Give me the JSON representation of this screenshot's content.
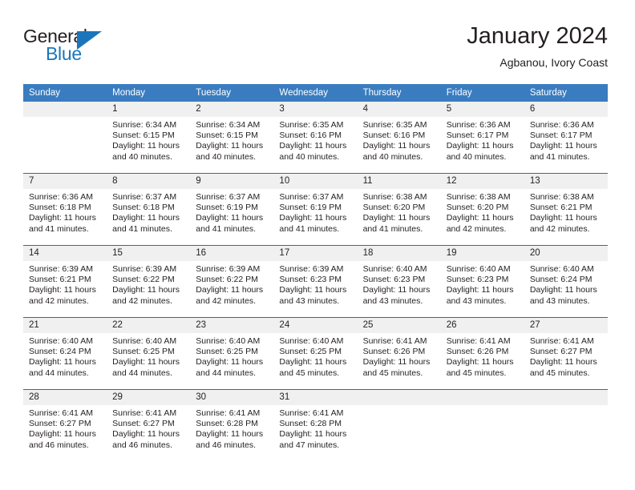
{
  "brand": {
    "word_one": "General",
    "word_two": "Blue",
    "triangle_icon": "brand-triangle-icon",
    "accent_color": "#1b75bb"
  },
  "header": {
    "title": "January 2024",
    "subtitle": "Agbanou, Ivory Coast"
  },
  "calendar": {
    "header_background": "#3a7cc0",
    "daynum_background": "#f0f0f0",
    "weekday_headers": [
      "Sunday",
      "Monday",
      "Tuesday",
      "Wednesday",
      "Thursday",
      "Friday",
      "Saturday"
    ],
    "weeks": [
      [
        {
          "day": "",
          "sunrise": "",
          "sunset": "",
          "daylight_1": "",
          "daylight_2": "",
          "empty": true
        },
        {
          "day": "1",
          "sunrise": "Sunrise: 6:34 AM",
          "sunset": "Sunset: 6:15 PM",
          "daylight_1": "Daylight: 11 hours",
          "daylight_2": "and 40 minutes.",
          "empty": false
        },
        {
          "day": "2",
          "sunrise": "Sunrise: 6:34 AM",
          "sunset": "Sunset: 6:15 PM",
          "daylight_1": "Daylight: 11 hours",
          "daylight_2": "and 40 minutes.",
          "empty": false
        },
        {
          "day": "3",
          "sunrise": "Sunrise: 6:35 AM",
          "sunset": "Sunset: 6:16 PM",
          "daylight_1": "Daylight: 11 hours",
          "daylight_2": "and 40 minutes.",
          "empty": false
        },
        {
          "day": "4",
          "sunrise": "Sunrise: 6:35 AM",
          "sunset": "Sunset: 6:16 PM",
          "daylight_1": "Daylight: 11 hours",
          "daylight_2": "and 40 minutes.",
          "empty": false
        },
        {
          "day": "5",
          "sunrise": "Sunrise: 6:36 AM",
          "sunset": "Sunset: 6:17 PM",
          "daylight_1": "Daylight: 11 hours",
          "daylight_2": "and 40 minutes.",
          "empty": false
        },
        {
          "day": "6",
          "sunrise": "Sunrise: 6:36 AM",
          "sunset": "Sunset: 6:17 PM",
          "daylight_1": "Daylight: 11 hours",
          "daylight_2": "and 41 minutes.",
          "empty": false
        }
      ],
      [
        {
          "day": "7",
          "sunrise": "Sunrise: 6:36 AM",
          "sunset": "Sunset: 6:18 PM",
          "daylight_1": "Daylight: 11 hours",
          "daylight_2": "and 41 minutes.",
          "empty": false
        },
        {
          "day": "8",
          "sunrise": "Sunrise: 6:37 AM",
          "sunset": "Sunset: 6:18 PM",
          "daylight_1": "Daylight: 11 hours",
          "daylight_2": "and 41 minutes.",
          "empty": false
        },
        {
          "day": "9",
          "sunrise": "Sunrise: 6:37 AM",
          "sunset": "Sunset: 6:19 PM",
          "daylight_1": "Daylight: 11 hours",
          "daylight_2": "and 41 minutes.",
          "empty": false
        },
        {
          "day": "10",
          "sunrise": "Sunrise: 6:37 AM",
          "sunset": "Sunset: 6:19 PM",
          "daylight_1": "Daylight: 11 hours",
          "daylight_2": "and 41 minutes.",
          "empty": false
        },
        {
          "day": "11",
          "sunrise": "Sunrise: 6:38 AM",
          "sunset": "Sunset: 6:20 PM",
          "daylight_1": "Daylight: 11 hours",
          "daylight_2": "and 41 minutes.",
          "empty": false
        },
        {
          "day": "12",
          "sunrise": "Sunrise: 6:38 AM",
          "sunset": "Sunset: 6:20 PM",
          "daylight_1": "Daylight: 11 hours",
          "daylight_2": "and 42 minutes.",
          "empty": false
        },
        {
          "day": "13",
          "sunrise": "Sunrise: 6:38 AM",
          "sunset": "Sunset: 6:21 PM",
          "daylight_1": "Daylight: 11 hours",
          "daylight_2": "and 42 minutes.",
          "empty": false
        }
      ],
      [
        {
          "day": "14",
          "sunrise": "Sunrise: 6:39 AM",
          "sunset": "Sunset: 6:21 PM",
          "daylight_1": "Daylight: 11 hours",
          "daylight_2": "and 42 minutes.",
          "empty": false
        },
        {
          "day": "15",
          "sunrise": "Sunrise: 6:39 AM",
          "sunset": "Sunset: 6:22 PM",
          "daylight_1": "Daylight: 11 hours",
          "daylight_2": "and 42 minutes.",
          "empty": false
        },
        {
          "day": "16",
          "sunrise": "Sunrise: 6:39 AM",
          "sunset": "Sunset: 6:22 PM",
          "daylight_1": "Daylight: 11 hours",
          "daylight_2": "and 42 minutes.",
          "empty": false
        },
        {
          "day": "17",
          "sunrise": "Sunrise: 6:39 AM",
          "sunset": "Sunset: 6:23 PM",
          "daylight_1": "Daylight: 11 hours",
          "daylight_2": "and 43 minutes.",
          "empty": false
        },
        {
          "day": "18",
          "sunrise": "Sunrise: 6:40 AM",
          "sunset": "Sunset: 6:23 PM",
          "daylight_1": "Daylight: 11 hours",
          "daylight_2": "and 43 minutes.",
          "empty": false
        },
        {
          "day": "19",
          "sunrise": "Sunrise: 6:40 AM",
          "sunset": "Sunset: 6:23 PM",
          "daylight_1": "Daylight: 11 hours",
          "daylight_2": "and 43 minutes.",
          "empty": false
        },
        {
          "day": "20",
          "sunrise": "Sunrise: 6:40 AM",
          "sunset": "Sunset: 6:24 PM",
          "daylight_1": "Daylight: 11 hours",
          "daylight_2": "and 43 minutes.",
          "empty": false
        }
      ],
      [
        {
          "day": "21",
          "sunrise": "Sunrise: 6:40 AM",
          "sunset": "Sunset: 6:24 PM",
          "daylight_1": "Daylight: 11 hours",
          "daylight_2": "and 44 minutes.",
          "empty": false
        },
        {
          "day": "22",
          "sunrise": "Sunrise: 6:40 AM",
          "sunset": "Sunset: 6:25 PM",
          "daylight_1": "Daylight: 11 hours",
          "daylight_2": "and 44 minutes.",
          "empty": false
        },
        {
          "day": "23",
          "sunrise": "Sunrise: 6:40 AM",
          "sunset": "Sunset: 6:25 PM",
          "daylight_1": "Daylight: 11 hours",
          "daylight_2": "and 44 minutes.",
          "empty": false
        },
        {
          "day": "24",
          "sunrise": "Sunrise: 6:40 AM",
          "sunset": "Sunset: 6:25 PM",
          "daylight_1": "Daylight: 11 hours",
          "daylight_2": "and 45 minutes.",
          "empty": false
        },
        {
          "day": "25",
          "sunrise": "Sunrise: 6:41 AM",
          "sunset": "Sunset: 6:26 PM",
          "daylight_1": "Daylight: 11 hours",
          "daylight_2": "and 45 minutes.",
          "empty": false
        },
        {
          "day": "26",
          "sunrise": "Sunrise: 6:41 AM",
          "sunset": "Sunset: 6:26 PM",
          "daylight_1": "Daylight: 11 hours",
          "daylight_2": "and 45 minutes.",
          "empty": false
        },
        {
          "day": "27",
          "sunrise": "Sunrise: 6:41 AM",
          "sunset": "Sunset: 6:27 PM",
          "daylight_1": "Daylight: 11 hours",
          "daylight_2": "and 45 minutes.",
          "empty": false
        }
      ],
      [
        {
          "day": "28",
          "sunrise": "Sunrise: 6:41 AM",
          "sunset": "Sunset: 6:27 PM",
          "daylight_1": "Daylight: 11 hours",
          "daylight_2": "and 46 minutes.",
          "empty": false
        },
        {
          "day": "29",
          "sunrise": "Sunrise: 6:41 AM",
          "sunset": "Sunset: 6:27 PM",
          "daylight_1": "Daylight: 11 hours",
          "daylight_2": "and 46 minutes.",
          "empty": false
        },
        {
          "day": "30",
          "sunrise": "Sunrise: 6:41 AM",
          "sunset": "Sunset: 6:28 PM",
          "daylight_1": "Daylight: 11 hours",
          "daylight_2": "and 46 minutes.",
          "empty": false
        },
        {
          "day": "31",
          "sunrise": "Sunrise: 6:41 AM",
          "sunset": "Sunset: 6:28 PM",
          "daylight_1": "Daylight: 11 hours",
          "daylight_2": "and 47 minutes.",
          "empty": false
        },
        {
          "day": "",
          "sunrise": "",
          "sunset": "",
          "daylight_1": "",
          "daylight_2": "",
          "empty": true
        },
        {
          "day": "",
          "sunrise": "",
          "sunset": "",
          "daylight_1": "",
          "daylight_2": "",
          "empty": true
        },
        {
          "day": "",
          "sunrise": "",
          "sunset": "",
          "daylight_1": "",
          "daylight_2": "",
          "empty": true
        }
      ]
    ]
  }
}
